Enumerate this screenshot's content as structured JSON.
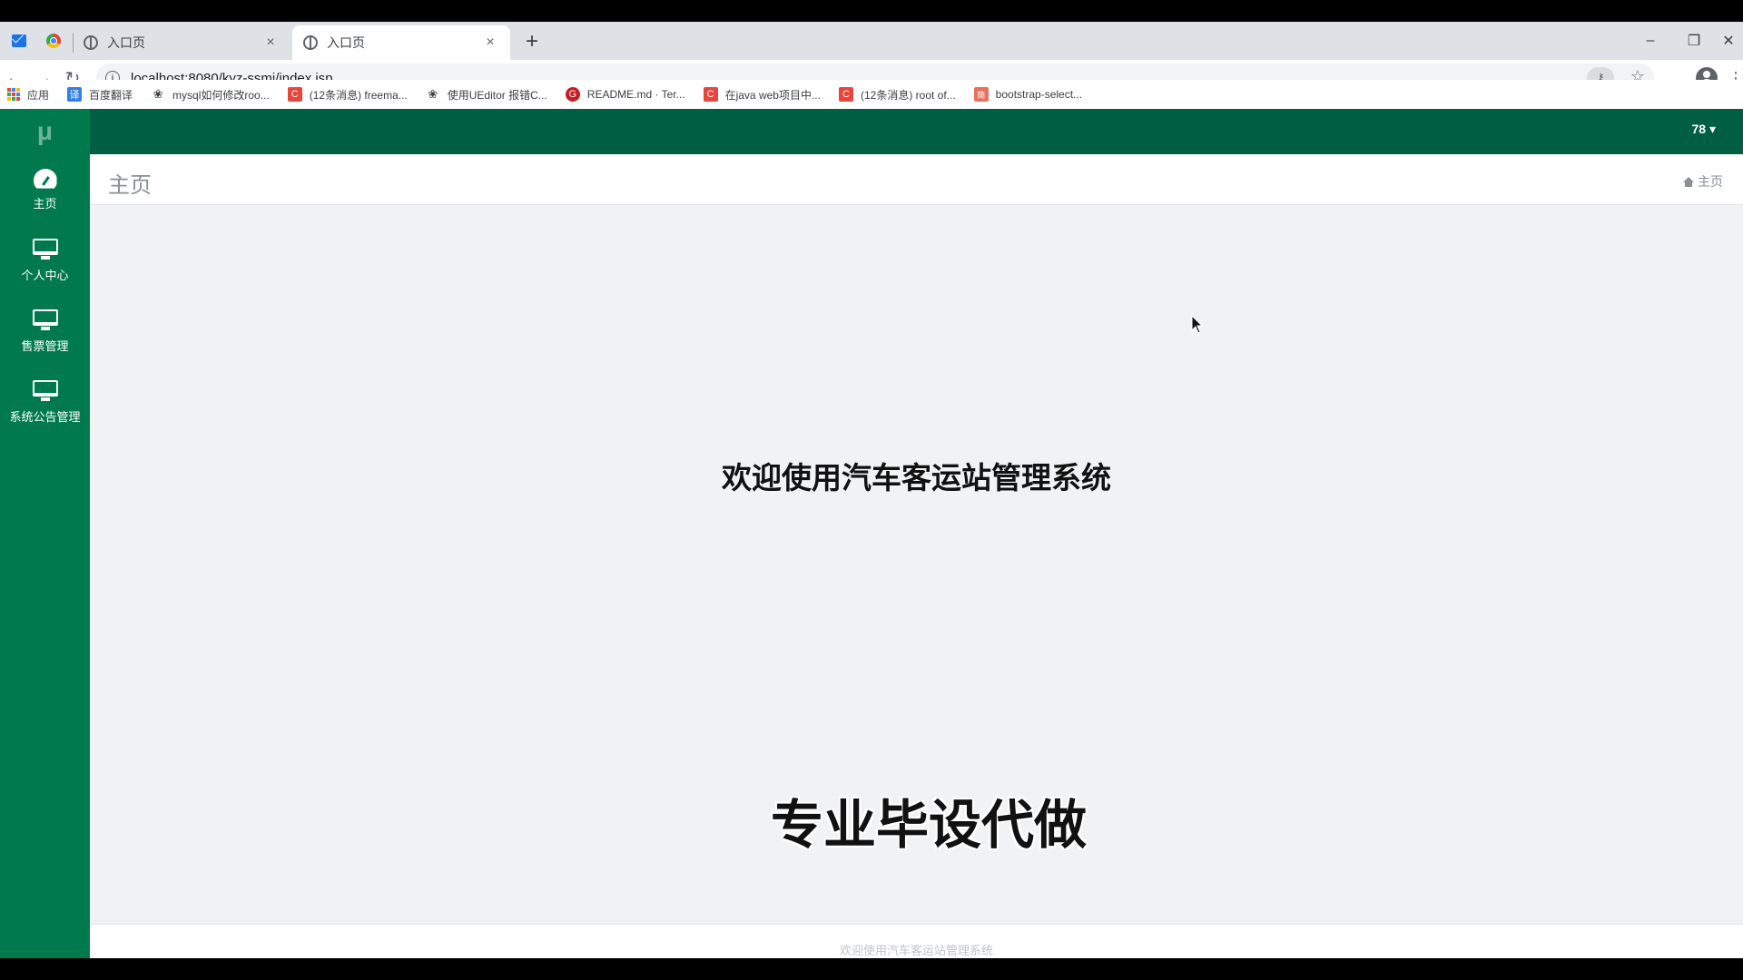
{
  "browser": {
    "tabs": [
      {
        "title": "入口页",
        "close": "×",
        "active": false
      },
      {
        "title": "入口页",
        "close": "×",
        "active": true
      }
    ],
    "new_tab": "+",
    "window_controls": {
      "minimize": "–",
      "restore": "❐",
      "close": "✕"
    },
    "url": "localhost:8080/kyz-ssmj/index.jsp",
    "bookmarks": [
      {
        "label": "应用",
        "icon": "apps-grid-icon"
      },
      {
        "label": "百度翻译",
        "icon": "translate-icon",
        "color": "#2f7fe8",
        "glyph": "译"
      },
      {
        "label": "mysql如何修改roo...",
        "icon": "paw-icon",
        "color": "#ffffff",
        "glyph": "❀"
      },
      {
        "label": "(12条消息) freema...",
        "icon": "csdn-icon",
        "color": "#e8453c",
        "glyph": "C"
      },
      {
        "label": "使用UEditor 报错C...",
        "icon": "paw-icon",
        "color": "#ffffff",
        "glyph": "❀"
      },
      {
        "label": "README.md · Ter...",
        "icon": "gitee-icon",
        "color": "#c71d23",
        "glyph": "G"
      },
      {
        "label": "在java web项目中...",
        "icon": "csdn-icon",
        "color": "#e8453c",
        "glyph": "C"
      },
      {
        "label": "(12条消息) root of...",
        "icon": "csdn-icon",
        "color": "#e8453c",
        "glyph": "C"
      },
      {
        "label": "bootstrap-select...",
        "icon": "jianshu-icon",
        "color": "#ea6f5a",
        "glyph": "簡"
      }
    ]
  },
  "app": {
    "brand": "μ",
    "accent": "#007a4d",
    "topbar_color": "#005e42",
    "user": "78 ▾",
    "sidebar": [
      {
        "label": "主页",
        "icon": "dashboard-icon"
      },
      {
        "label": "个人中心",
        "icon": "monitor-icon"
      },
      {
        "label": "售票管理",
        "icon": "monitor-icon"
      },
      {
        "label": "系统公告管理",
        "icon": "monitor-icon"
      }
    ],
    "page_title": "主页",
    "breadcrumb": "主页",
    "welcome": "欢迎使用汽车客运站管理系统",
    "footer": "欢迎使用汽车客运站管理系统",
    "watermark": "专业毕设代做"
  }
}
